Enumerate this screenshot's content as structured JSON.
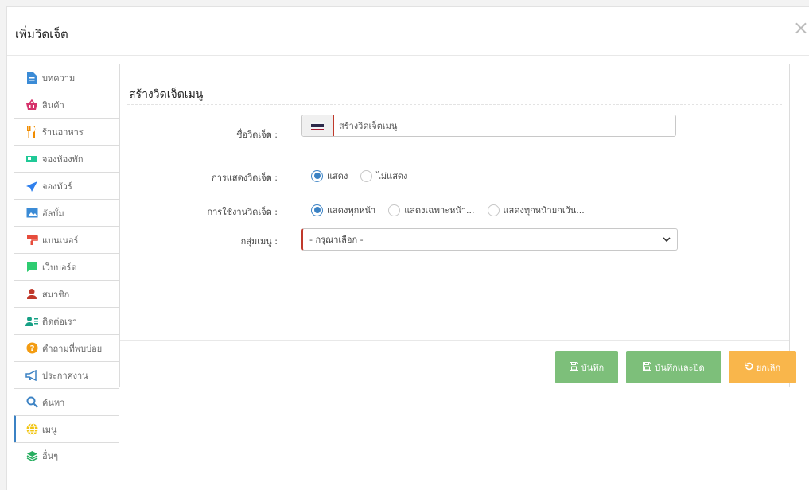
{
  "modal": {
    "title": "เพิ่มวิดเจ็ต",
    "close": "×"
  },
  "sidebar": {
    "items": [
      {
        "label": "บทความ",
        "icon": "document-icon",
        "color": "#3b8bd6"
      },
      {
        "label": "สินค้า",
        "icon": "basket-icon",
        "color": "#d6336c"
      },
      {
        "label": "ร้านอาหาร",
        "icon": "utensils-icon",
        "color": "#f08c00"
      },
      {
        "label": "จองห้องพัก",
        "icon": "bed-icon",
        "color": "#20c997"
      },
      {
        "label": "จองทัวร์",
        "icon": "plane-icon",
        "color": "#2f80ed"
      },
      {
        "label": "อัลบั้ม",
        "icon": "image-icon",
        "color": "#3b8bd6"
      },
      {
        "label": "แบนเนอร์",
        "icon": "paint-roller-icon",
        "color": "#e74c3c"
      },
      {
        "label": "เว็บบอร์ด",
        "icon": "chat-icon",
        "color": "#2ecc71"
      },
      {
        "label": "สมาชิก",
        "icon": "user-icon",
        "color": "#c0392b"
      },
      {
        "label": "ติดต่อเรา",
        "icon": "contact-icon",
        "color": "#16a085"
      },
      {
        "label": "คำถามที่พบบ่อย",
        "icon": "question-icon",
        "color": "#f39c12"
      },
      {
        "label": "ประกาศงาน",
        "icon": "megaphone-icon",
        "color": "#3b82c4"
      },
      {
        "label": "ค้นหา",
        "icon": "search-icon",
        "color": "#3b82c4"
      },
      {
        "label": "เมนู",
        "icon": "globe-icon",
        "color": "#f1c40f",
        "active": true
      },
      {
        "label": "อื่นๆ",
        "icon": "layers-icon",
        "color": "#27ae60"
      }
    ]
  },
  "panel": {
    "title": "สร้างวิดเจ็ตเมนู",
    "name_label": "ชื่อวิดเจ็ต :",
    "name_value": "สร้างวิดเจ็ตเมนู",
    "display_label": "การแสดงวิดเจ็ต :",
    "display_options": [
      "แสดง",
      "ไม่แสดง"
    ],
    "usage_label": "การใช้งานวิดเจ็ต :",
    "usage_options": [
      "แสดงทุกหน้า",
      "แสดงเฉพาะหน้า...",
      "แสดงทุกหน้ายกเว้น..."
    ],
    "group_label": "กลุ่มเมนู :",
    "group_value": "- กรุณาเลือก -"
  },
  "buttons": {
    "save": "บันทึก",
    "save_close": "บันทึกและปิด",
    "cancel": "ยกเลิก"
  }
}
